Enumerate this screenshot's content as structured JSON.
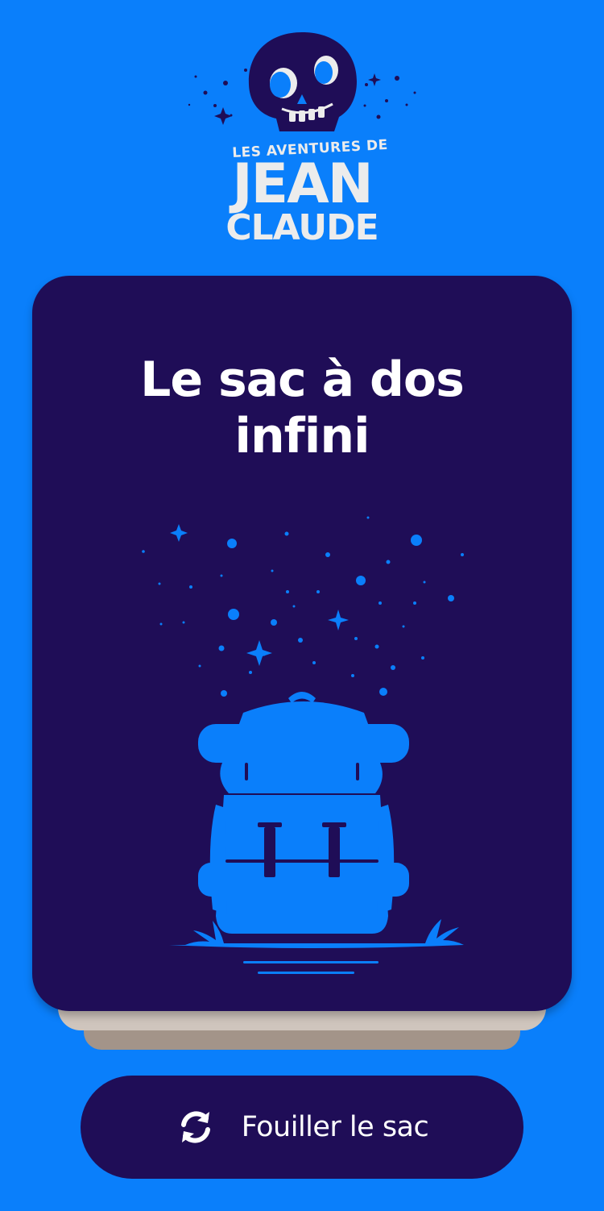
{
  "logo": {
    "line1": "LES AVENTURES DE",
    "line2": "JEAN",
    "line3": "CLAUDE",
    "icon": "skull-icon"
  },
  "card": {
    "title": "Le sac à dos infini",
    "illustration": "backpack-icon"
  },
  "action": {
    "label": "Fouiller le sac",
    "icon": "refresh-icon"
  },
  "colors": {
    "background": "#0a7ffb",
    "card": "#1f0d57",
    "accent": "#0a7ffb",
    "text": "#ffffff",
    "logo_text": "#ececec"
  }
}
